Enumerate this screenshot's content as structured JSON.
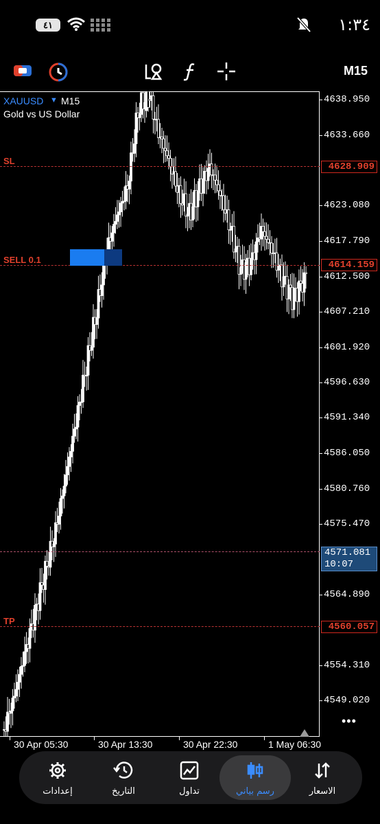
{
  "status": {
    "time": "١:٣٤",
    "battery": "٤١"
  },
  "toolbar": {
    "timeframe": "M15"
  },
  "chart": {
    "symbol": "XAUUSD",
    "timeframe": "M15",
    "description": "Gold vs US Dollar",
    "price_axis": [
      "4638.950",
      "4633.660",
      "4623.080",
      "4617.790",
      "4612.500",
      "4607.210",
      "4601.920",
      "4596.630",
      "4591.340",
      "4586.050",
      "4580.760",
      "4575.470",
      "4564.890",
      "4554.310",
      "4549.020"
    ],
    "sl": {
      "label": "SL",
      "price": "4628.909"
    },
    "sell": {
      "label": "SELL 0.1",
      "price": "4614.159"
    },
    "tp": {
      "label": "TP",
      "price": "4560.057"
    },
    "bid": {
      "price": "4571.081",
      "countdown": "10:07"
    },
    "time_axis": [
      "30 Apr 05:30",
      "30 Apr 13:30",
      "30 Apr 22:30",
      "1 May 06:30"
    ],
    "more": "•••"
  },
  "nav": {
    "items": [
      {
        "label": "إعدادات",
        "icon": "gear-icon"
      },
      {
        "label": "التاريخ",
        "icon": "history-icon"
      },
      {
        "label": "تداول",
        "icon": "trade-icon"
      },
      {
        "label": "رسم بياني",
        "icon": "candles-icon",
        "active": true
      },
      {
        "label": "الاسعار",
        "icon": "quotes-icon"
      }
    ],
    "active_color": "#3a8cff"
  }
}
